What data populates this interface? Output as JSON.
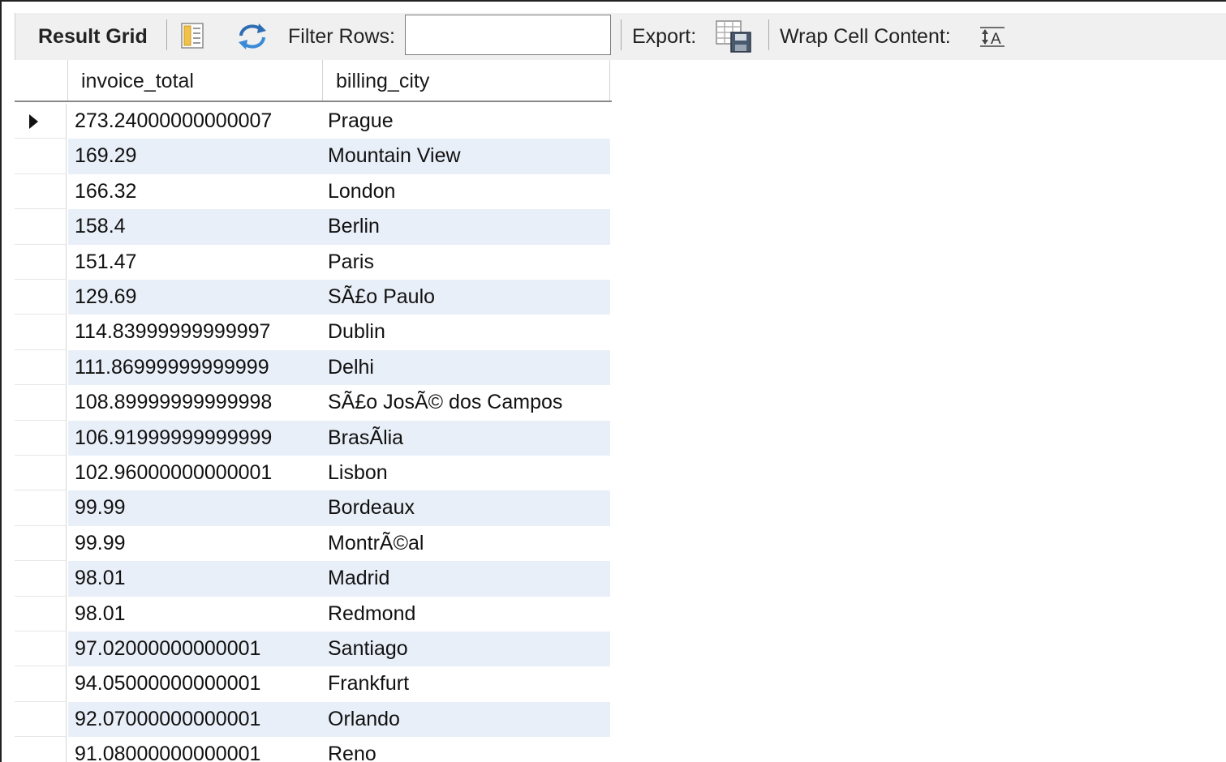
{
  "toolbar": {
    "result_grid_label": "Result Grid",
    "filter_label": "Filter Rows:",
    "filter_value": "",
    "export_label": "Export:",
    "wrap_label": "Wrap Cell Content:"
  },
  "icons": {
    "form_editor": "form-editor-icon",
    "refresh": "refresh-icon",
    "export": "export-icon",
    "wrap": "wrap-cell-icon"
  },
  "grid": {
    "columns": [
      "invoice_total",
      "billing_city"
    ],
    "rows": [
      [
        "273.24000000000007",
        "Prague"
      ],
      [
        "169.29",
        "Mountain View"
      ],
      [
        "166.32",
        "London"
      ],
      [
        "158.4",
        "Berlin"
      ],
      [
        "151.47",
        "Paris"
      ],
      [
        "129.69",
        "SÃ£o Paulo"
      ],
      [
        "114.83999999999997",
        "Dublin"
      ],
      [
        "111.86999999999999",
        "Delhi"
      ],
      [
        "108.89999999999998",
        "SÃ£o JosÃ© dos Campos"
      ],
      [
        "106.91999999999999",
        "BrasÃ­lia"
      ],
      [
        "102.96000000000001",
        "Lisbon"
      ],
      [
        "99.99",
        "Bordeaux"
      ],
      [
        "99.99",
        "MontrÃ©al"
      ],
      [
        "98.01",
        "Madrid"
      ],
      [
        "98.01",
        "Redmond"
      ],
      [
        "97.02000000000001",
        "Santiago"
      ],
      [
        "94.05000000000001",
        "Frankfurt"
      ],
      [
        "92.07000000000001",
        "Orlando"
      ],
      [
        "91.08000000000001",
        "Reno"
      ]
    ]
  }
}
